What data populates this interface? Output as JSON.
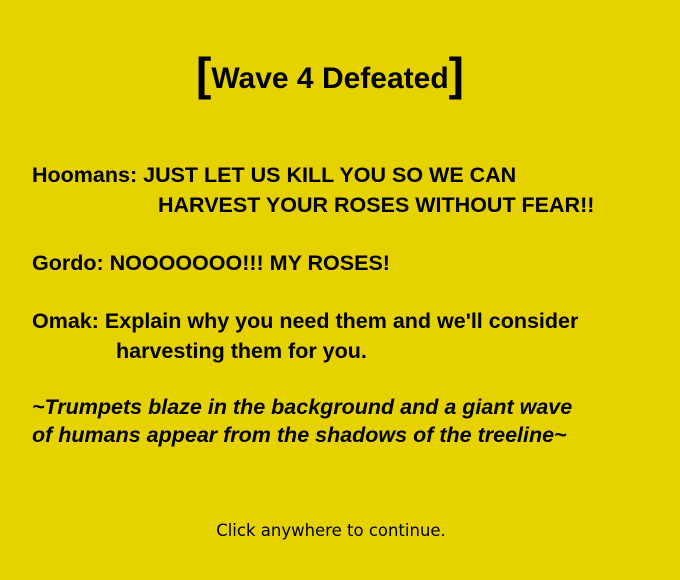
{
  "title": {
    "open_bracket": "[",
    "text": "Wave 4 Defeated",
    "close_bracket": "]"
  },
  "dialogue": [
    {
      "speaker": "Hoomans:",
      "line1": "JUST LET US KILL YOU SO WE CAN",
      "line2": "HARVEST YOUR ROSES WITHOUT FEAR!!"
    },
    {
      "speaker": "Gordo:",
      "line1": "NOOOOOOO!!! MY ROSES!",
      "line2": ""
    },
    {
      "speaker": "Omak:",
      "line1": "Explain why you need them and we'll consider",
      "line2": "harvesting them for you."
    }
  ],
  "narration": {
    "line1": "~Trumpets blaze in the background and a giant wave",
    "line2": "of humans appear from the shadows of the treeline~"
  },
  "prompt": "Click anywhere to continue.",
  "colors": {
    "background": "#e6d200",
    "text": "#000000"
  }
}
